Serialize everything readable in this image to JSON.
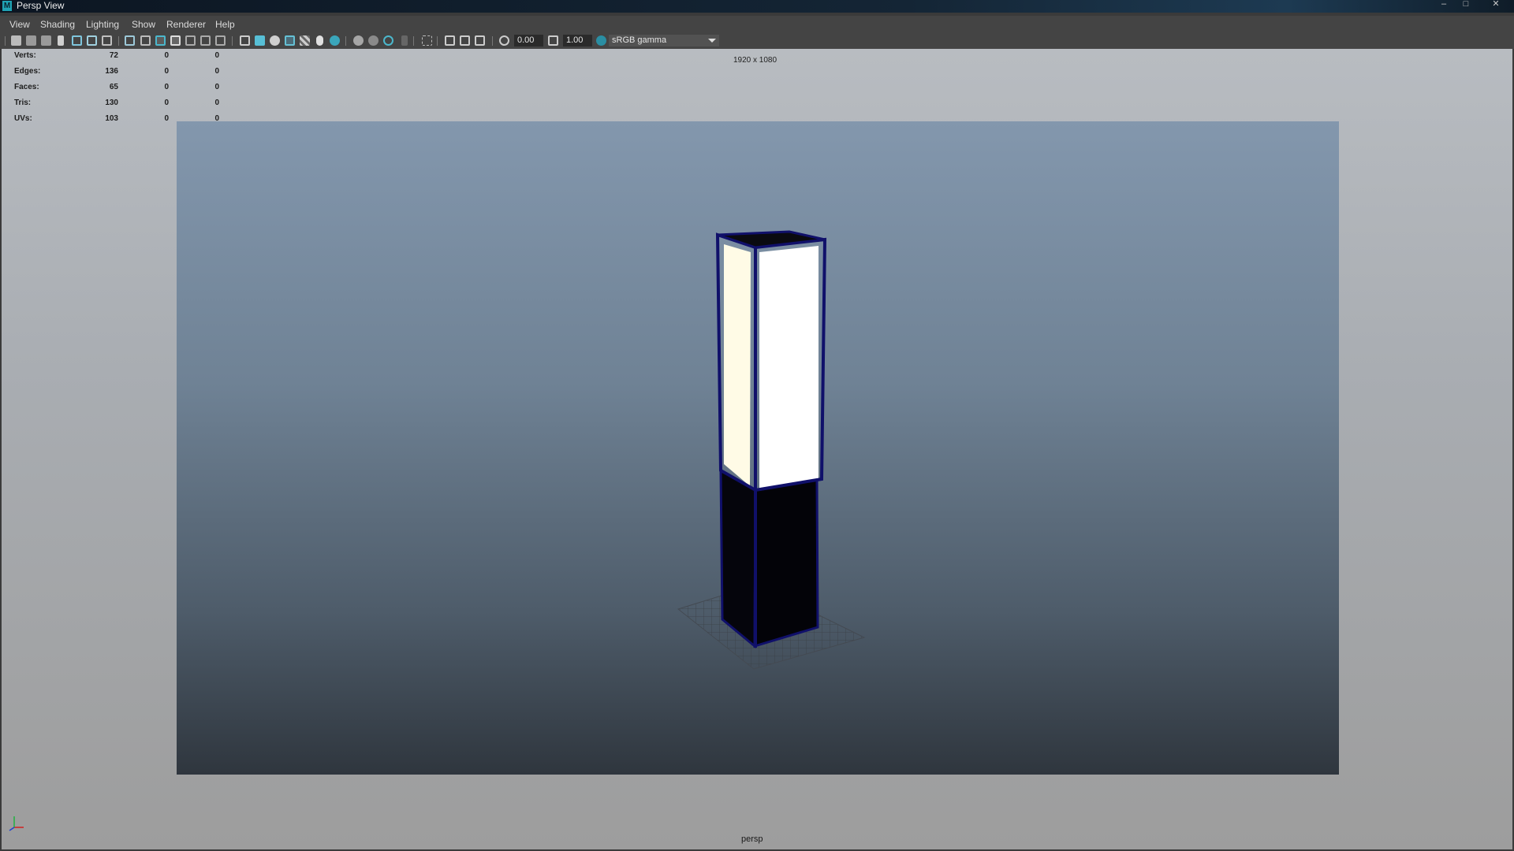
{
  "window": {
    "title": "Persp View",
    "app_icon_letter": "M"
  },
  "menubar": {
    "items": [
      {
        "label": "View"
      },
      {
        "label": "Shading"
      },
      {
        "label": "Lighting"
      },
      {
        "label": "Show"
      },
      {
        "label": "Renderer"
      },
      {
        "label": "Help"
      }
    ]
  },
  "toolbar": {
    "exposure_value": "0.00",
    "gamma_value": "1.00",
    "color_space": "sRGB gamma",
    "icons": [
      "camera-icon",
      "camera-attributes-icon",
      "bookmark-camera-icon",
      "bookmark-icon",
      "image-plane-icon",
      "2d-pan-zoom-icon",
      "grease-pencil-icon",
      "grid-icon",
      "film-gate-icon",
      "resolution-gate-icon",
      "gate-mask-icon",
      "field-chart-icon",
      "safe-action-icon",
      "safe-title-icon",
      "wireframe-icon",
      "smooth-shade-icon",
      "default-lighting-icon",
      "wireframe-on-shaded-icon",
      "textured-icon",
      "use-all-lights-icon",
      "shadows-icon",
      "screen-space-ao-icon",
      "motion-blur-icon",
      "anti-aliasing-icon",
      "depth-of-field-icon",
      "isolate-select-icon",
      "xray-icon",
      "xray-joints-icon",
      "backface-icon",
      "exposure-icon",
      "gamma-icon",
      "color-management-icon"
    ]
  },
  "hud": {
    "stats": [
      {
        "label": "Verts:",
        "v1": "72",
        "v2": "0",
        "v3": "0"
      },
      {
        "label": "Edges:",
        "v1": "136",
        "v2": "0",
        "v3": "0"
      },
      {
        "label": "Faces:",
        "v1": "65",
        "v2": "0",
        "v3": "0"
      },
      {
        "label": "Tris:",
        "v1": "130",
        "v2": "0",
        "v3": "0"
      },
      {
        "label": "UVs:",
        "v1": "103",
        "v2": "0",
        "v3": "0"
      }
    ],
    "resolution": "1920 x 1080",
    "camera": "persp"
  },
  "colors": {
    "wire_highlight": "#10106a",
    "light_panel_left": "#fffbe6",
    "light_panel_right": "#ffffff",
    "dark_body": "#05050c"
  }
}
